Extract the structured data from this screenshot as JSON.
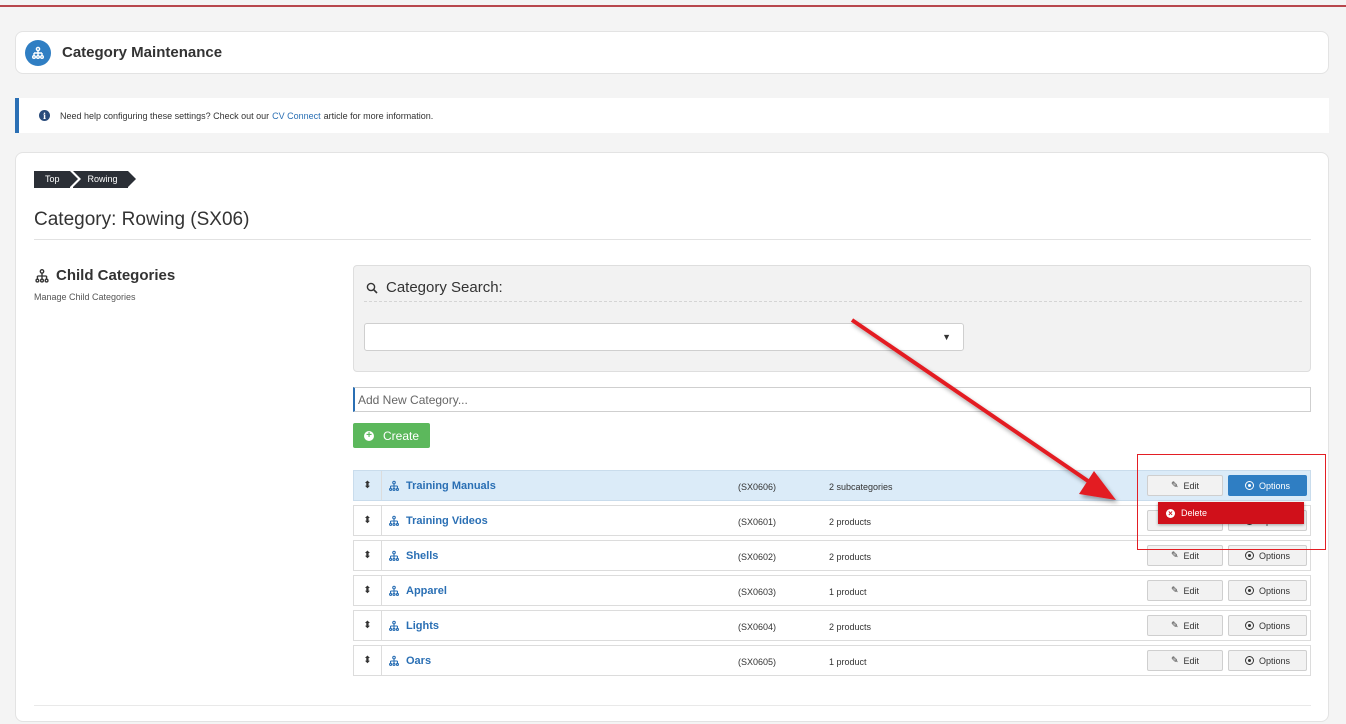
{
  "header": {
    "title": "Category Maintenance",
    "icon": "sitemap-icon"
  },
  "info": {
    "prefix": "Need help configuring these settings? Check out our",
    "link": "CV Connect",
    "suffix": "article for more information."
  },
  "breadcrumb": [
    "Top",
    "Rowing"
  ],
  "page_title": "Category: Rowing (SX06)",
  "sidebar": {
    "title": "Child Categories",
    "subtitle": "Manage Child Categories"
  },
  "search": {
    "label": "Category Search:",
    "selected": ""
  },
  "add_category": {
    "placeholder": "Add New Category...",
    "value": ""
  },
  "create_button": "Create",
  "categories": [
    {
      "name": "Training Manuals",
      "code": "(SX0606)",
      "count": "2 subcategories",
      "edit": "Edit",
      "options": "Options"
    },
    {
      "name": "Training Videos",
      "code": "(SX0601)",
      "count": "2 products",
      "edit": "Edit",
      "options": "Options"
    },
    {
      "name": "Shells",
      "code": "(SX0602)",
      "count": "2 products",
      "edit": "Edit",
      "options": "Options"
    },
    {
      "name": "Apparel",
      "code": "(SX0603)",
      "count": "1 product",
      "edit": "Edit",
      "options": "Options"
    },
    {
      "name": "Lights",
      "code": "(SX0604)",
      "count": "2 products",
      "edit": "Edit",
      "options": "Options"
    },
    {
      "name": "Oars",
      "code": "(SX0605)",
      "count": "1 product",
      "edit": "Edit",
      "options": "Options"
    }
  ],
  "options_menu": {
    "delete": "Delete"
  },
  "colors": {
    "accent": "#2f7ec3",
    "create": "#5cb85c",
    "delete": "#d0101a",
    "annotation": "#e31e24"
  }
}
